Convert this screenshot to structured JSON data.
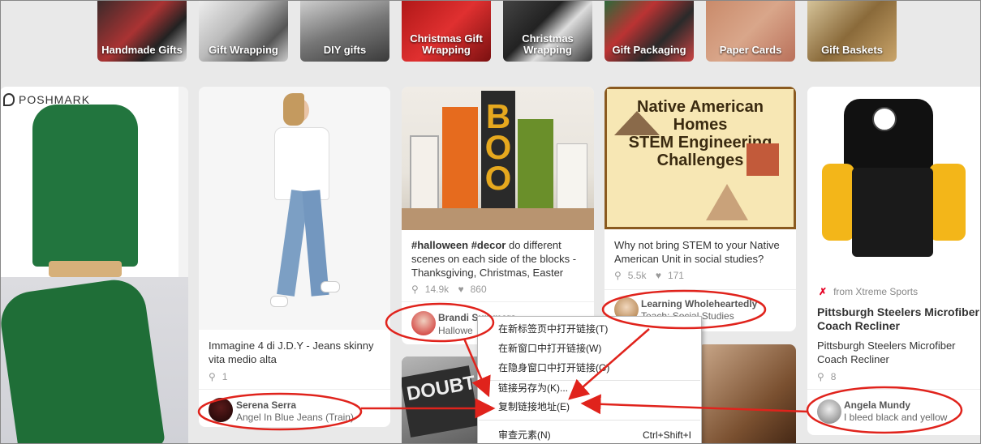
{
  "categories": [
    {
      "label": "Handmade Gifts"
    },
    {
      "label": "Gift Wrapping"
    },
    {
      "label": "DIY gifts"
    },
    {
      "label": "Christmas Gift Wrapping"
    },
    {
      "label": "Christmas Wrapping"
    },
    {
      "label": "Gift Packaging"
    },
    {
      "label": "Paper Cards"
    },
    {
      "label": "Gift Baskets"
    }
  ],
  "pins": {
    "poshmark": {
      "brand": "POSHMARK"
    },
    "jeans": {
      "description": "Immagine 4 di J.D.Y - Jeans skinny vita medio alta",
      "repins": "1",
      "user_name": "Serena Serra",
      "user_board": "Angel In Blue Jeans (Train)"
    },
    "boo": {
      "hashtag1": "#halloween",
      "hashtag2": "#decor",
      "description_rest": "do different scenes on each side of the blocks - Thanksgiving, Christmas, Easter",
      "repins": "14.9k",
      "likes": "860",
      "user_name": "Brandi Summers",
      "user_board": "Hallowe"
    },
    "native": {
      "img_title1": "Native American",
      "img_title2": "Homes",
      "img_title3": "STEM Engineering",
      "img_title4": "Challenges",
      "description": "Why not bring STEM to your Native American Unit in social studies?",
      "repins": "5.5k",
      "likes": "171",
      "user_name": "Learning Wholeheartedly",
      "user_board": "Teach: Social Studies"
    },
    "doubt": {
      "img_text": "DOUBT"
    },
    "steelers": {
      "source": "from Xtreme Sports",
      "title": "Pittsburgh Steelers Microfiber Coach Recliner",
      "description": "Pittsburgh Steelers Microfiber Coach Recliner",
      "repins": "8",
      "user_name": "Angela Mundy",
      "user_board": "I bleed black and yellow"
    }
  },
  "context_menu": {
    "items": [
      {
        "label": "在新标签页中打开链接(T)"
      },
      {
        "label": "在新窗口中打开链接(W)"
      },
      {
        "label": "在隐身窗口中打开链接(G)"
      },
      {
        "label": "链接另存为(K)..."
      },
      {
        "label": "复制链接地址(E)"
      },
      {
        "label": "审查元素(N)",
        "shortcut": "Ctrl+Shift+I"
      }
    ]
  },
  "colors": {
    "annotation_red": "#e0231c",
    "pinterest_red": "#e60023"
  }
}
